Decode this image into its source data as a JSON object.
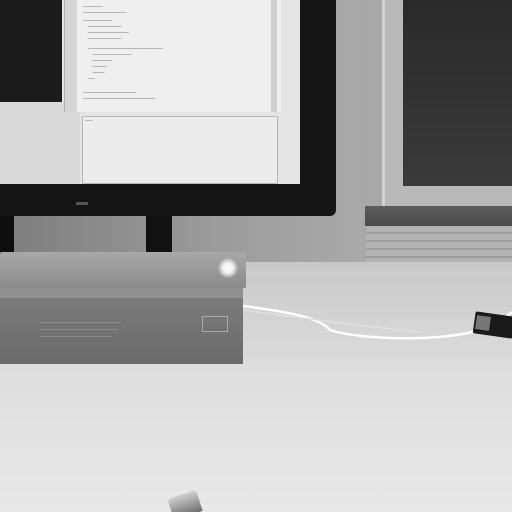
{
  "scene": {
    "description_alt": "Grayscale photo of a desk with a monitor showing code, a box with an LED light bar, and a cable",
    "colors": {
      "wall": "#9a9a9a",
      "desk": "#dedede",
      "monitor_bezel": "#141414",
      "led": "#ffffff"
    }
  },
  "icons": {
    "usb": "usb-plug-icon",
    "light": "led-light-icon"
  }
}
